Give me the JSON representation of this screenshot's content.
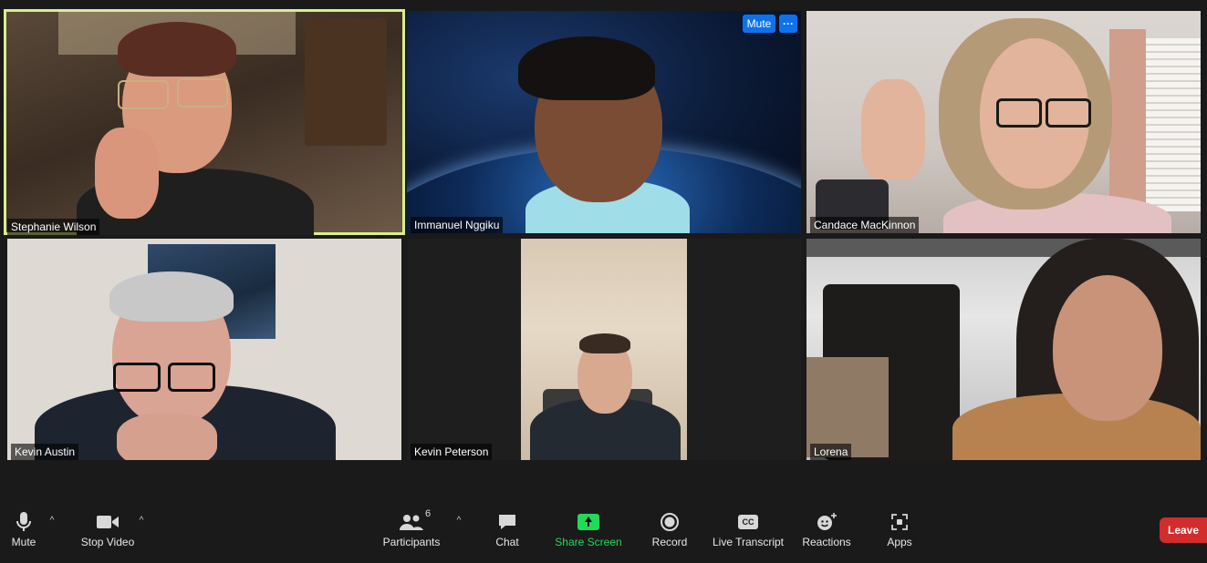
{
  "participants_tiles": [
    {
      "name": "Stephanie Wilson"
    },
    {
      "name": "Immanuel Nggiku"
    },
    {
      "name": "Candace MacKinnon"
    },
    {
      "name": "Kevin Austin"
    },
    {
      "name": "Kevin Peterson"
    },
    {
      "name": "Lorena"
    }
  ],
  "tile_overlay": {
    "mute_label": "Mute",
    "more_label": "···"
  },
  "toolbar": {
    "mute": {
      "label": "Mute",
      "icon": "microphone-icon"
    },
    "video": {
      "label": "Stop Video",
      "icon": "video-camera-icon"
    },
    "participants": {
      "label": "Participants",
      "count": "6",
      "icon": "participants-icon"
    },
    "chat": {
      "label": "Chat",
      "icon": "chat-bubble-icon"
    },
    "share": {
      "label": "Share Screen",
      "icon": "share-screen-icon",
      "color": "#23d959"
    },
    "record": {
      "label": "Record",
      "icon": "record-icon"
    },
    "transcript": {
      "label": "Live Transcript",
      "badge": "CC",
      "icon": "cc-icon"
    },
    "reactions": {
      "label": "Reactions",
      "icon": "smiley-plus-icon"
    },
    "apps": {
      "label": "Apps",
      "icon": "apps-icon"
    },
    "leave": {
      "label": "Leave",
      "color": "#d22c2c"
    }
  },
  "colors": {
    "speaker_outline": "#d8ef8a",
    "accent_blue": "#0e72ed"
  }
}
